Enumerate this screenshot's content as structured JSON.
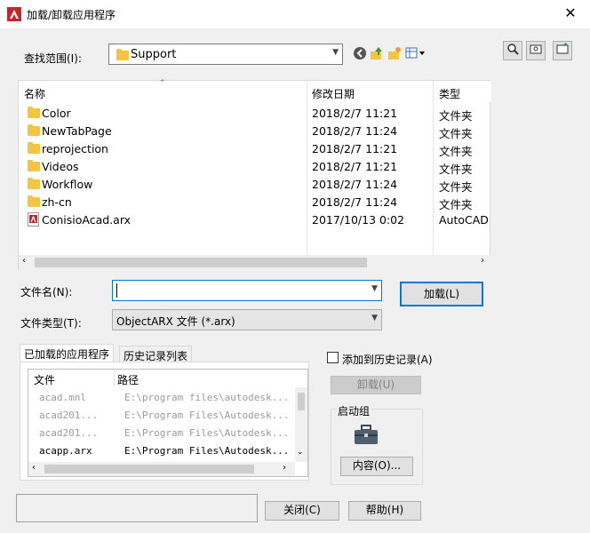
{
  "window": {
    "title": "加载/卸载应用程序",
    "close_glyph": "✕"
  },
  "lookin": {
    "label": "查找范围(I):",
    "value": "Support"
  },
  "colors": {
    "accent": "#0078d7",
    "folder": "#f5c542",
    "autocad_red": "#c7252e"
  },
  "file_list": {
    "columns": [
      "名称",
      "修改日期",
      "类型"
    ],
    "rows": [
      {
        "name": "Color",
        "date": "2018/2/7 11:21",
        "type": "文件夹",
        "icon": "folder-icon"
      },
      {
        "name": "NewTabPage",
        "date": "2018/2/7 11:24",
        "type": "文件夹",
        "icon": "folder-icon"
      },
      {
        "name": "reprojection",
        "date": "2018/2/7 11:21",
        "type": "文件夹",
        "icon": "folder-icon"
      },
      {
        "name": "Videos",
        "date": "2018/2/7 11:21",
        "type": "文件夹",
        "icon": "folder-icon"
      },
      {
        "name": "Workflow",
        "date": "2018/2/7 11:24",
        "type": "文件夹",
        "icon": "folder-icon"
      },
      {
        "name": "zh-cn",
        "date": "2018/2/7 11:24",
        "type": "文件夹",
        "icon": "folder-icon"
      },
      {
        "name": "ConisioAcad.arx",
        "date": "2017/10/13 0:02",
        "type": "AutoCAD",
        "icon": "arx-file-icon"
      }
    ]
  },
  "filename": {
    "label": "文件名(N):",
    "value": ""
  },
  "filetype": {
    "label": "文件类型(T):",
    "value": "ObjectARX 文件 (*.arx)"
  },
  "buttons": {
    "load": "加载(L)",
    "unload": "卸载(U)",
    "contents": "内容(O)...",
    "close": "关闭(C)",
    "help": "帮助(H)"
  },
  "tabs": {
    "loaded": "已加载的应用程序",
    "history": "历史记录列表"
  },
  "loaded_list": {
    "columns": [
      "文件",
      "路径"
    ],
    "rows": [
      {
        "file": "acad.mnl",
        "path": "E:\\program files\\autodesk...",
        "dim": true
      },
      {
        "file": "acad201...",
        "path": "E:\\Program Files\\Autodesk...",
        "dim": true
      },
      {
        "file": "acad201...",
        "path": "E:\\Program Files\\Autodesk...",
        "dim": true
      },
      {
        "file": "acapp.arx",
        "path": "E:\\Program Files\\Autodesk...",
        "dim": false
      }
    ]
  },
  "history_checkbox": {
    "label": "添加到历史记录(A)",
    "checked": false
  },
  "startup_group": {
    "label": "启动组"
  }
}
